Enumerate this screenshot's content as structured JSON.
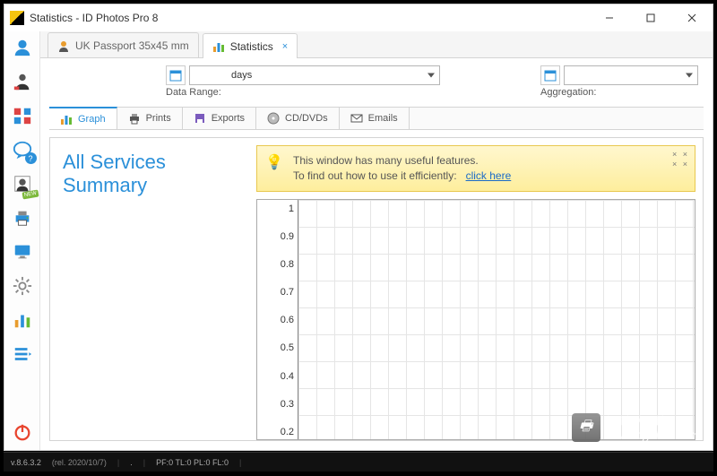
{
  "window": {
    "title": "Statistics - ID Photos Pro 8"
  },
  "doc_tabs": [
    {
      "label": "UK Passport 35x45 mm",
      "icon": "person-icon",
      "active": false
    },
    {
      "label": "Statistics",
      "icon": "stats-icon",
      "active": true,
      "closable": true
    }
  ],
  "range": {
    "data_range_label": "Data Range:",
    "aggregation_label": "Aggregation:",
    "days_label": "days"
  },
  "sub_tabs": [
    {
      "label": "Graph",
      "icon": "chart-icon",
      "active": true
    },
    {
      "label": "Prints",
      "icon": "printer-icon"
    },
    {
      "label": "Exports",
      "icon": "save-icon"
    },
    {
      "label": "CD/DVDs",
      "icon": "disc-icon"
    },
    {
      "label": "Emails",
      "icon": "mail-icon"
    }
  ],
  "summary": {
    "title": "All Services Summary"
  },
  "tip": {
    "line1": "This window has many useful features.",
    "line2": "To find out how to use it efficiently:",
    "link": "click here"
  },
  "status": {
    "version": "v.8.6.3.2",
    "release": "(rel. 2020/10/7)",
    "dot": ".",
    "codes": "PF:0  TL:0  PL:0  FL:0"
  },
  "watermark": {
    "text": "www.djydbk.com",
    "sub": "打印机大百科"
  },
  "chart_data": {
    "type": "line",
    "title": "All Services Summary",
    "xlabel": "",
    "ylabel": "",
    "ylim": [
      0.2,
      1
    ],
    "y_ticks": [
      1,
      0.9,
      0.8,
      0.7,
      0.6,
      0.5,
      0.4,
      0.3,
      0.2
    ],
    "categories": [],
    "series": []
  }
}
